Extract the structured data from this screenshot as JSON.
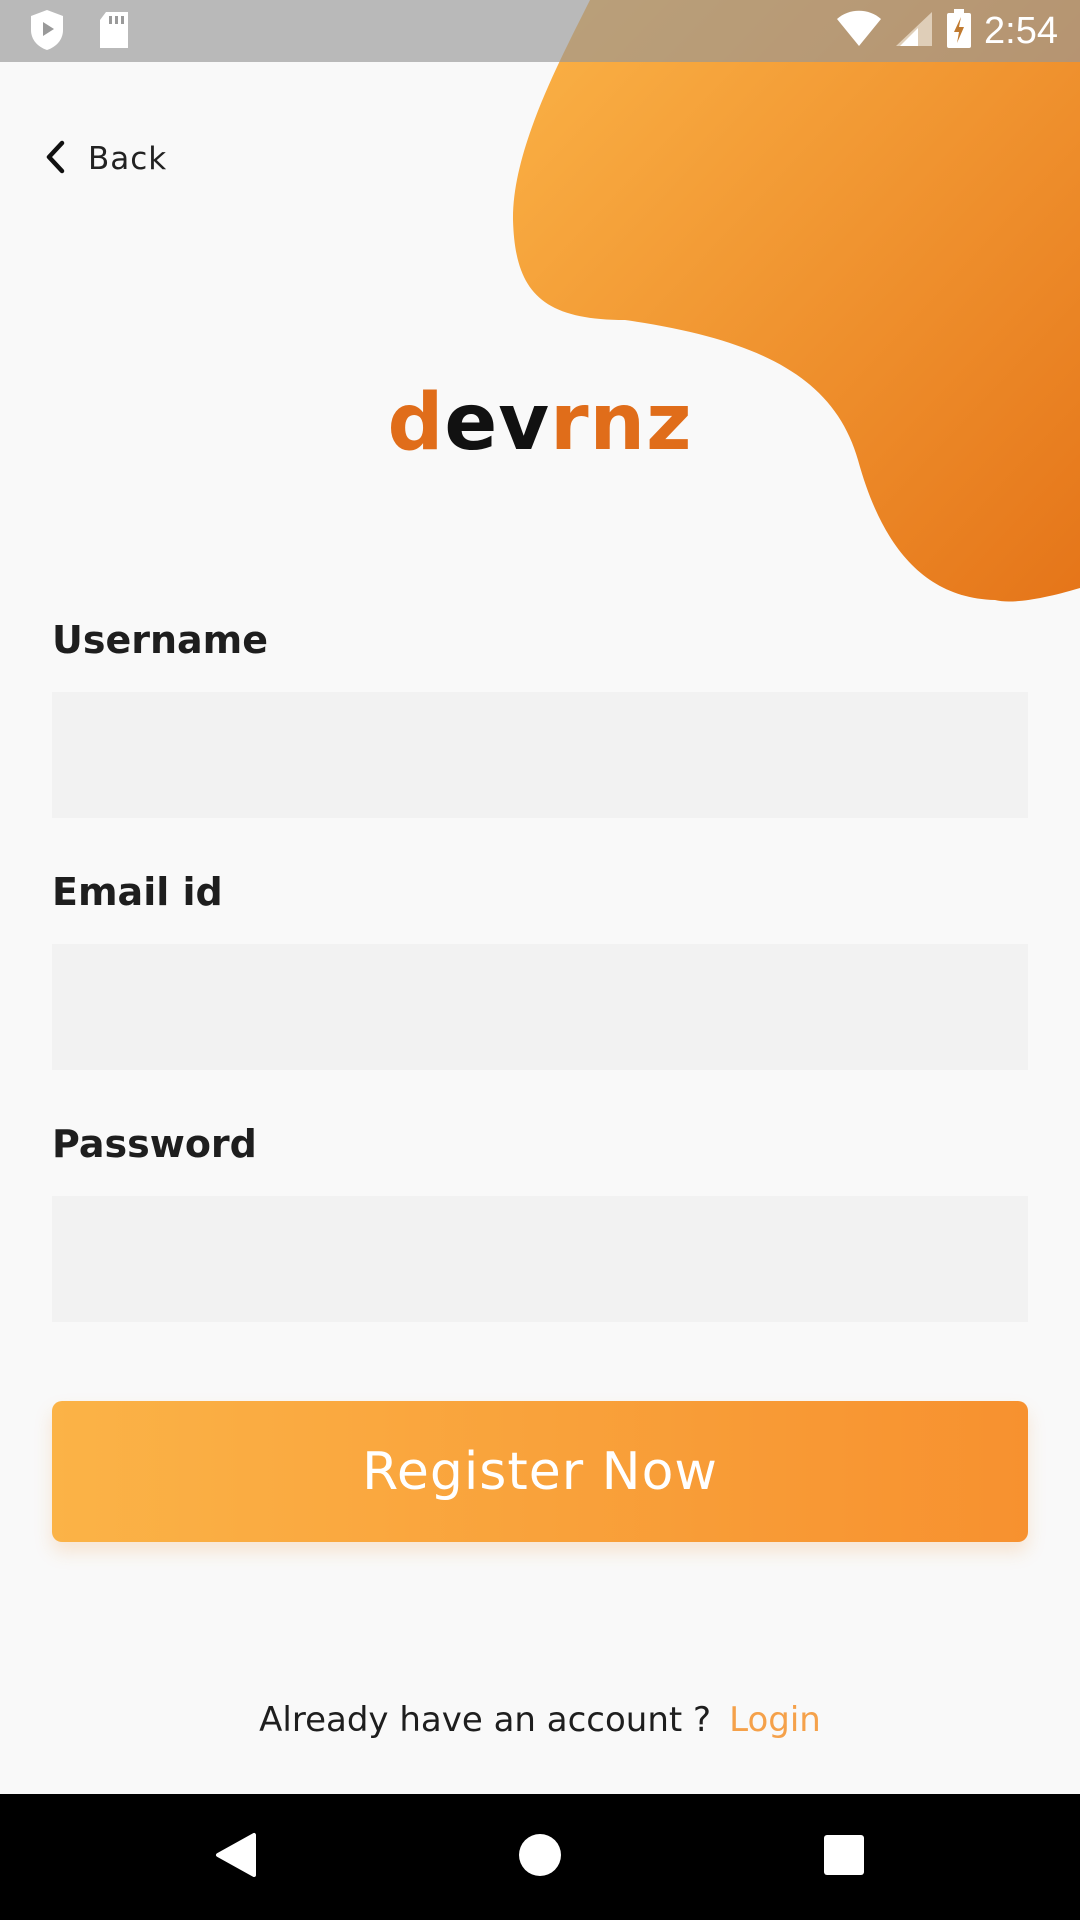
{
  "status_bar": {
    "time": "2:54",
    "icons": [
      "shield-play-icon",
      "sd-card-icon",
      "wifi-icon",
      "signal-icon",
      "battery-charging-icon"
    ]
  },
  "header": {
    "back_label": "Back"
  },
  "logo": {
    "part1": "d",
    "part2": "ev",
    "part3": "rnz"
  },
  "form": {
    "username_label": "Username",
    "username_value": "",
    "email_label": "Email id",
    "email_value": "",
    "password_label": "Password",
    "password_value": ""
  },
  "register_button": {
    "label": "Register Now"
  },
  "footer": {
    "prompt": "Already have an account ?",
    "login_label": "Login"
  },
  "nav_bar": {
    "icons": [
      "back-triangle-icon",
      "home-circle-icon",
      "recents-square-icon"
    ]
  },
  "colors": {
    "accent": "#f7912f",
    "accent_light": "#fbb347",
    "logo_orange": "#e06d1a",
    "link": "#f5a14a",
    "field_bg": "#f2f2f2",
    "background": "#f9f9f9"
  }
}
